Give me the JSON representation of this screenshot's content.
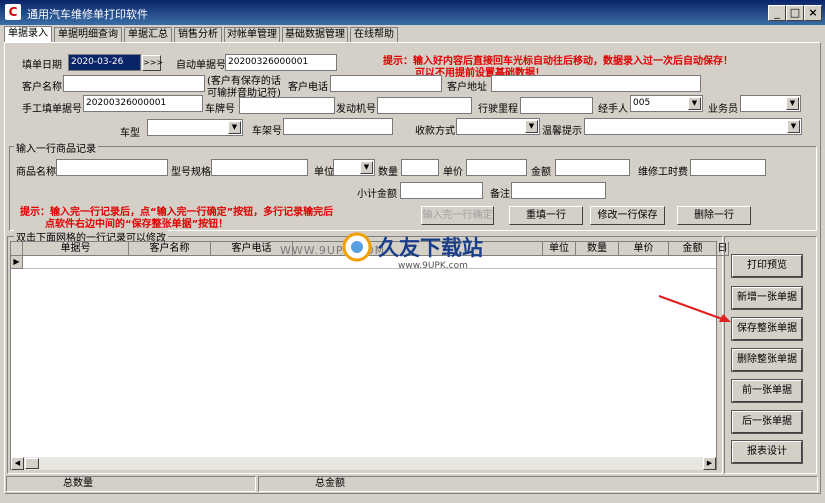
{
  "window": {
    "title": "通用汽车维修单打印软件",
    "icon": "app-icon"
  },
  "tabs": [
    "单据录入",
    "单据明细查询",
    "单据汇总",
    "销售分析",
    "对帐单管理",
    "基础数据管理",
    "在线帮助"
  ],
  "header": {
    "date_label": "填单日期",
    "date_value": "2020-03-26",
    "date_btn": ">>>",
    "auto_no_label": "自动单据号",
    "auto_no_value": "20200326000001",
    "hint1": "提示：输入好内容后直接回车光标自动往后移动，数据录入过一次后自动保存！",
    "hint2": "可以不用提前设置基础数据！",
    "customer_label": "客户名称",
    "customer_note1": "(客户有保存的话",
    "customer_note2": "可输拼音助记符)",
    "phone_label": "客户电话",
    "address_label": "客户地址",
    "manual_no_label": "手工填单据号",
    "manual_no_value": "20200326000001",
    "plate_label": "车牌号",
    "engine_label": "发动机号",
    "mileage_label": "行驶里程",
    "handler_label": "经手人",
    "handler_value": "005",
    "salesman_label": "业务员",
    "model_label": "车型",
    "frame_label": "车架号",
    "payment_label": "收款方式",
    "reminder_label": "温馨提示"
  },
  "item": {
    "group_title": "输入一行商品记录",
    "name_label": "商品名称",
    "spec_label": "型号规格",
    "unit_label": "单位",
    "qty_label": "数量",
    "price_label": "单价",
    "amount_label": "金额",
    "labor_label": "维修工时费",
    "subtotal_label": "小计金额",
    "remark_label": "备注",
    "hint1": "提示：输入完一行记录后，点“输入完一行确定”按钮，多行记录输完后",
    "hint2": "点软件右边中间的“保存整张单据”按钮！",
    "confirm_btn": "输入完一行确定",
    "refill_btn": "重填一行",
    "modify_btn": "修改一行保存",
    "delete_btn": "删除一行"
  },
  "grid": {
    "group_title": "双击下面网格的一行记录可以修改",
    "columns": [
      "单据号",
      "客户名称",
      "客户电话",
      "",
      "单位",
      "数量",
      "单价",
      "金额",
      "日"
    ]
  },
  "watermark": {
    "url": "WWW.9UPK.COM",
    "logo": "久友下载站",
    "logo_url": "www.9UPK.com"
  },
  "actions": [
    "打印预览",
    "新增一张单据",
    "保存整张单据",
    "删除整张单据",
    "前一张单据",
    "后一张单据",
    "报表设计"
  ],
  "status": {
    "count_label": "总数量",
    "total_label": "总金额"
  },
  "colors": {
    "title_bar": "#0a246a",
    "hint_red": "#e00000",
    "selection": "#0a246a",
    "arrow": "#e02020"
  }
}
